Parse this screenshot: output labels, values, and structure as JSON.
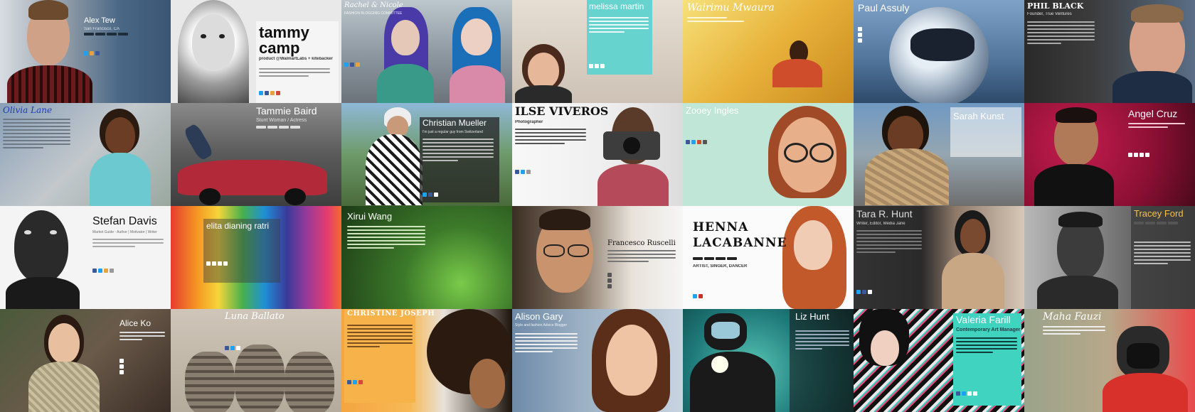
{
  "collage": {
    "tiles": [
      {
        "name": "Alex Tew",
        "subtitle": "San Francisco, CA"
      },
      {
        "name_line1": "tammy",
        "name_line2": "camp",
        "subtitle": "product @WalmartLabs + kitebacker"
      },
      {
        "name": "Rachel & Nicole",
        "subtitle": "FASHION BLOGGING COMMITTEE"
      },
      {
        "name": "melissa martin"
      },
      {
        "name": "Wairimu Mwaura"
      },
      {
        "name": "Paul Assuly"
      },
      {
        "name": "PHIL BLACK",
        "subtitle": "Founder, True Ventures"
      },
      {
        "name": "Olivia Lane"
      },
      {
        "name": "Tammie Baird",
        "subtitle": "Stunt Woman / Actress"
      },
      {
        "name": "Christian Mueller",
        "subtitle": "I'm just a regular guy from Switzerland"
      },
      {
        "name": "ILSE VIVEROS",
        "subtitle": "Photographer"
      },
      {
        "name": "Zooey Ingles"
      },
      {
        "name": "Sarah Kunst"
      },
      {
        "name": "Angel Cruz"
      },
      {
        "name": "Stefan Davis",
        "subtitle": "Market Guide · Author | Motivator | Writer"
      },
      {
        "name": "elita dianing ratri"
      },
      {
        "name": "Xirui Wang"
      },
      {
        "name": "Francesco Ruscelli"
      },
      {
        "name_line1": "HENNA",
        "name_line2": "LACABANNE",
        "subtitle": "ARTIST, SINGER, DANCER"
      },
      {
        "name": "Tara R. Hunt",
        "subtitle": "Writer, Editor, Media Jane"
      },
      {
        "name": "Tracey Ford"
      },
      {
        "name": "Alice Ko"
      },
      {
        "name": "Luna Ballato"
      },
      {
        "name": "CHRISTINE JOSEPH"
      },
      {
        "name": "Alison Gary",
        "subtitle": "Style and fashion Advice Blogger"
      },
      {
        "name": "Liz Hunt"
      },
      {
        "name": "Valeria Farill",
        "subtitle": "Contemporary Art Manager"
      },
      {
        "name": "Maha Fauzi"
      }
    ]
  },
  "colors": {
    "facebook": "#3b5998",
    "twitter": "#1da1f2",
    "orange": "#f0a030",
    "teal": "#3fd3c0",
    "yellow": "#f6c244"
  }
}
